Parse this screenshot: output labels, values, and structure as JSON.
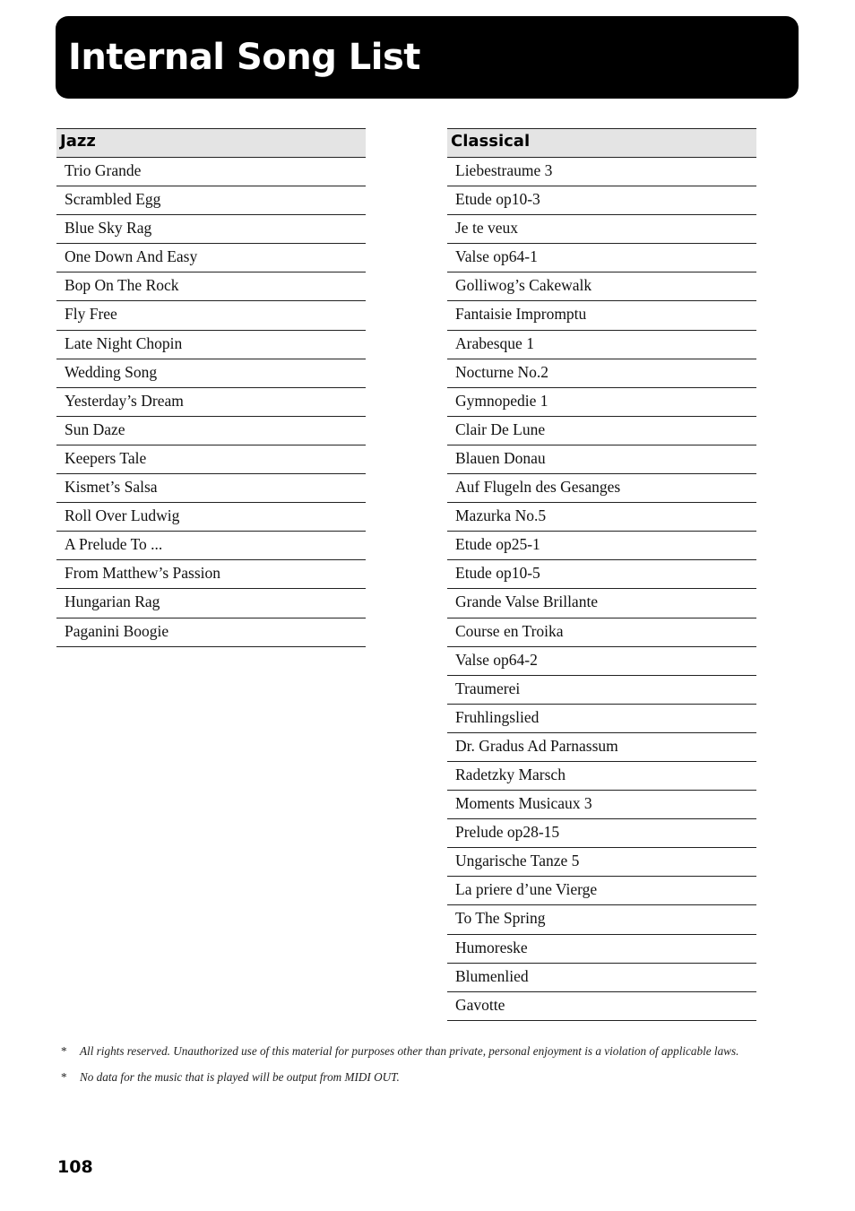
{
  "page": {
    "title": "Internal Song List",
    "page_number": "108"
  },
  "jazz": {
    "header": "Jazz",
    "songs": [
      "Trio Grande",
      "Scrambled Egg",
      "Blue Sky Rag",
      "One Down And Easy",
      "Bop On The Rock",
      "Fly Free",
      "Late Night Chopin",
      "Wedding Song",
      "Yesterday’s Dream",
      "Sun Daze",
      "Keepers Tale",
      "Kismet’s Salsa",
      "Roll Over Ludwig",
      "A Prelude To ...",
      "From Matthew’s Passion",
      "Hungarian Rag",
      "Paganini Boogie"
    ]
  },
  "classical": {
    "header": "Classical",
    "songs": [
      "Liebestraume 3",
      "Etude op10-3",
      "Je te veux",
      "Valse op64-1",
      "Golliwog’s Cakewalk",
      "Fantaisie Impromptu",
      "Arabesque 1",
      "Nocturne No.2",
      "Gymnopedie 1",
      "Clair De Lune",
      "Blauen Donau",
      "Auf Flugeln des Gesanges",
      "Mazurka No.5",
      "Etude op25-1",
      "Etude op10-5",
      "Grande Valse Brillante",
      "Course en Troika",
      "Valse op64-2",
      "Traumerei",
      "Fruhlingslied",
      "Dr. Gradus Ad Parnassum",
      "Radetzky Marsch",
      "Moments Musicaux 3",
      "Prelude op28-15",
      "Ungarische Tanze 5",
      "La priere d’une Vierge",
      "To The Spring",
      "Humoreske",
      "Blumenlied",
      "Gavotte"
    ]
  },
  "notes": [
    {
      "marker": "*",
      "text": "All rights reserved. Unauthorized use of this material for purposes other than private, personal enjoyment is a violation of applicable laws."
    },
    {
      "marker": "*",
      "text": "No data for the music that is played will be output from MIDI OUT."
    }
  ],
  "colors": {
    "title_bar_bg": "#000000",
    "title_text": "#ffffff",
    "table_header_bg": "#e4e4e4"
  }
}
